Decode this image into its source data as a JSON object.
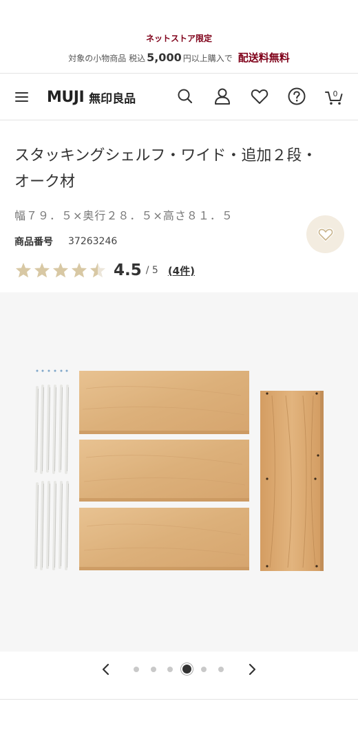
{
  "promo": {
    "title": "ネットストア限定",
    "line_prefix": "対象の小物商品 税込",
    "amount": "5,000",
    "line_suffix": "円以上購入で",
    "free_shipping": "配送料無料"
  },
  "header": {
    "logo_text": "MUJI",
    "logo_jp": "無印良品",
    "cart_count": "0",
    "icons": [
      "menu-icon",
      "search-icon",
      "account-icon",
      "heart-icon",
      "help-icon",
      "cart-icon"
    ]
  },
  "product": {
    "title": "スタッキングシェルフ・ワイド・追加２段・オーク材",
    "size": "幅７９．５×奥行２８．５×高さ８１．５",
    "number_label": "商品番号",
    "number_value": "37263246",
    "rating": {
      "score": "4.5",
      "max": "/ 5",
      "count": "(4件)",
      "stars_value": 4.5,
      "stars_total": 5
    }
  },
  "carousel": {
    "total": 6,
    "active_index": 3
  },
  "colors": {
    "brand": "#7f0019",
    "star": "#d8c8a4",
    "fav_bg": "#f3ece0"
  }
}
